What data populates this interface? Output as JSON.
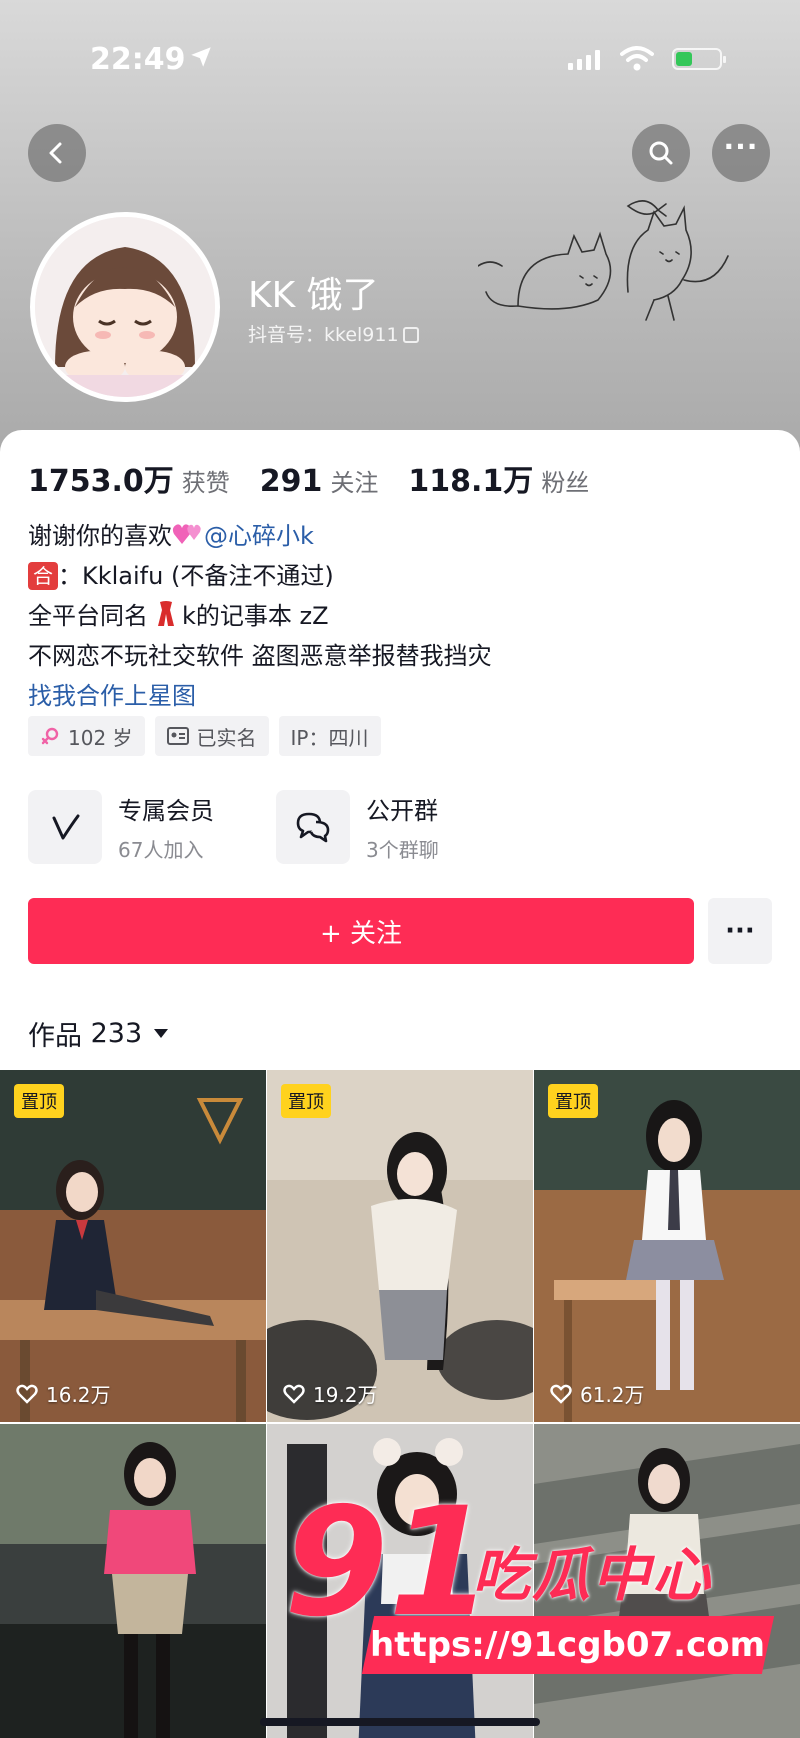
{
  "status_bar": {
    "time": "22:49"
  },
  "profile": {
    "nickname": "KK 饿了",
    "account": "抖音号：kkel911"
  },
  "stats": [
    {
      "value": "1753.0万",
      "label": "获赞"
    },
    {
      "value": "291",
      "label": "关注"
    },
    {
      "value": "118.1万",
      "label": "粉丝"
    }
  ],
  "bio": {
    "line1_text": "谢谢你的喜欢",
    "line1_mention": "@心碎小k",
    "line2_badge": "合",
    "line2_text": "：Kklaifu (不备注不通过)",
    "line3_prefix": "全平台同名",
    "line3_suffix": "k的记事本 zZ",
    "line4": "不网恋不玩社交软件 盗图恶意举报替我挡灾",
    "link": "找我合作上星图"
  },
  "tags": [
    {
      "icon": "female-icon",
      "text": "102 岁"
    },
    {
      "icon": "id-card-icon",
      "text": "已实名"
    },
    {
      "icon": "",
      "text": "IP：四川"
    }
  ],
  "entries": [
    {
      "icon": "vip-v-icon",
      "title": "专属会员",
      "sub": "67人加入"
    },
    {
      "icon": "chat-bubbles-icon",
      "title": "公开群",
      "sub": "3个群聊"
    }
  ],
  "actions": {
    "follow": "+ 关注",
    "more": "···"
  },
  "works": {
    "label": "作品",
    "count": "233",
    "items": [
      {
        "pinned": "置顶",
        "likes": "16.2万"
      },
      {
        "pinned": "置顶",
        "likes": "19.2万"
      },
      {
        "pinned": "置顶",
        "likes": "61.2万"
      },
      {
        "pinned": "",
        "likes": ""
      },
      {
        "pinned": "",
        "likes": ""
      },
      {
        "pinned": "",
        "likes": ""
      }
    ]
  },
  "watermark": {
    "number": "91",
    "name": "吃瓜中心",
    "url": "https://91cgb07.com"
  },
  "colors": {
    "accent": "#fe2c55",
    "link": "#2b5ea8",
    "pin": "#ffd21e"
  }
}
